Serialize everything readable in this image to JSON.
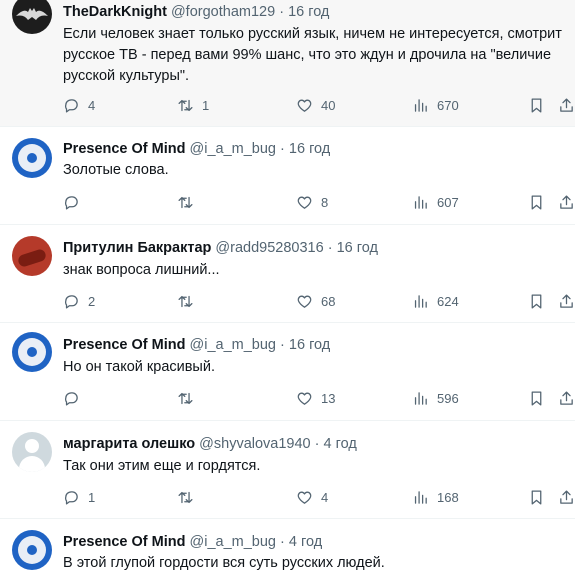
{
  "tweets": [
    {
      "name": "TheDarkKnight",
      "handle": "@forgotham129",
      "sep": "·",
      "time": "16 год",
      "text_lines": [
        "Если человек знает только русский язык, ничем не интересуется, смотрит",
        "русское ТВ - перед вами 99% шанс, что это ждун и дрочила на \"величие",
        "русской культуры\"."
      ],
      "replies": "4",
      "retweets": "1",
      "likes": "40",
      "views": "670"
    },
    {
      "name": "Presence Of Mind",
      "handle": "@i_a_m_bug",
      "sep": "·",
      "time": "16 год",
      "text_lines": [
        "Золотые слова."
      ],
      "replies": "",
      "retweets": "",
      "likes": "8",
      "views": "607"
    },
    {
      "name": "Притулин Бакрактар",
      "handle": "@radd95280316",
      "sep": "·",
      "time": "16 год",
      "text_lines": [
        "знак вопроса лишний..."
      ],
      "replies": "2",
      "retweets": "",
      "likes": "68",
      "views": "624"
    },
    {
      "name": "Presence Of Mind",
      "handle": "@i_a_m_bug",
      "sep": "·",
      "time": "16 год",
      "text_lines": [
        "Но он такой красивый."
      ],
      "replies": "",
      "retweets": "",
      "likes": "13",
      "views": "596"
    },
    {
      "name": "маргарита олешко",
      "handle": "@shyvalova1940",
      "sep": "·",
      "time": "4 год",
      "text_lines": [
        "Так они этим еще и гордятся."
      ],
      "replies": "1",
      "retweets": "",
      "likes": "4",
      "views": "168"
    },
    {
      "name": "Presence Of Mind",
      "handle": "@i_a_m_bug",
      "sep": "·",
      "time": "4 год",
      "text_lines": [
        "В этой глупой гордости вся суть русских людей."
      ]
    }
  ],
  "icons": {
    "reply": "reply-icon",
    "retweet": "retweet-icon",
    "like": "heart-icon",
    "views": "views-icon",
    "bookmark": "bookmark-icon",
    "share": "share-icon"
  }
}
